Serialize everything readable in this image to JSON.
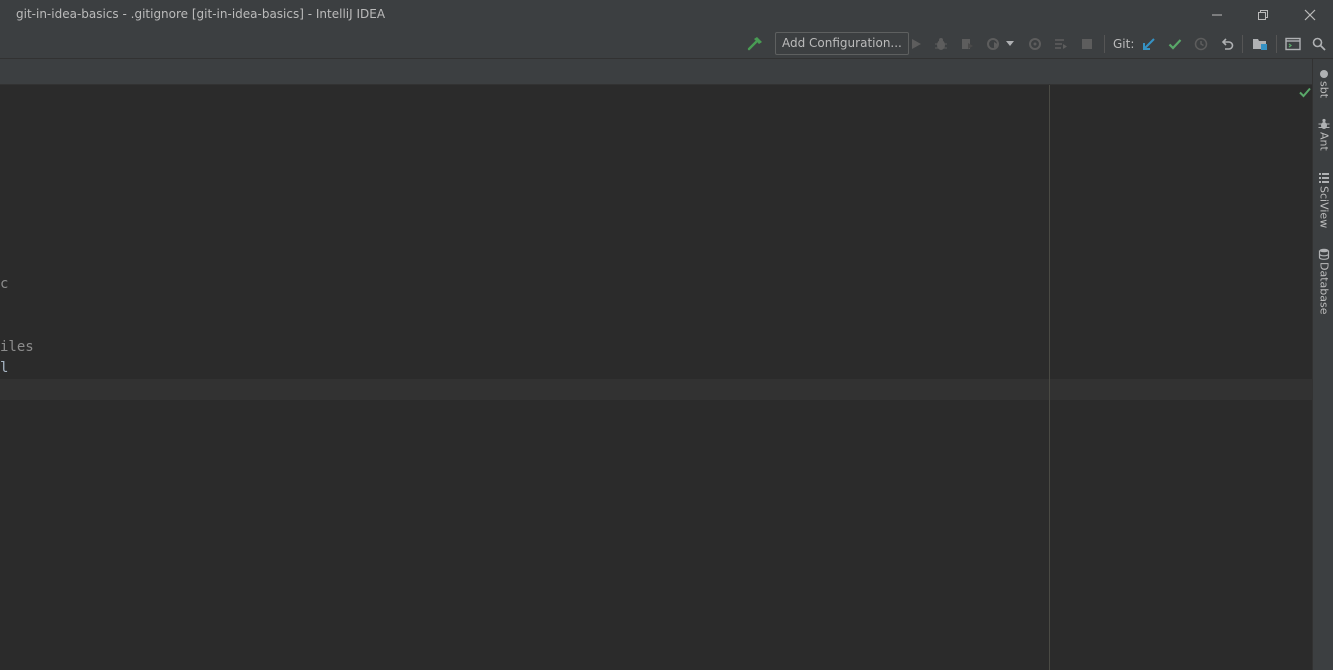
{
  "window": {
    "title": "git-in-idea-basics - .gitignore [git-in-idea-basics] - IntelliJ IDEA",
    "minimize_icon": "minimize-icon",
    "restore_icon": "restore-icon",
    "close_icon": "close-icon"
  },
  "toolbar": {
    "build_icon": "hammer-icon",
    "add_configuration_label": "Add Configuration...",
    "run_icon": "play-icon",
    "debug_icon": "bug-icon",
    "coverage_icon": "coverage-icon",
    "profile_icon": "profile-icon",
    "attach_icon": "attach-icon",
    "stop_icon": "stop-icon",
    "git_label": "Git:",
    "git_update_icon": "git-update-icon",
    "git_commit_icon": "git-commit-icon",
    "git_history_icon": "history-icon",
    "git_rollback_icon": "rollback-icon",
    "project_structure_icon": "project-structure-icon",
    "terminal_icon": "terminal-icon",
    "search_icon": "search-icon",
    "colors": {
      "build": "#499c54",
      "git_update": "#3592c4",
      "git_commit": "#59a869",
      "disabled": "#5d5d5d",
      "default": "#afb1b3"
    }
  },
  "editor": {
    "lines": [
      {
        "text": "c",
        "row": 9
      },
      {
        "text": "iles",
        "row": 12
      },
      {
        "text": "l",
        "row": 13
      }
    ],
    "inspection_ok_icon": "check-icon",
    "inspection_color": "#59a869"
  },
  "right_tools": [
    {
      "label": "sbt",
      "icon": "sbt-icon"
    },
    {
      "label": "Ant",
      "icon": "ant-icon"
    },
    {
      "label": "SciView",
      "icon": "sciview-icon"
    },
    {
      "label": "Database",
      "icon": "database-icon"
    }
  ]
}
